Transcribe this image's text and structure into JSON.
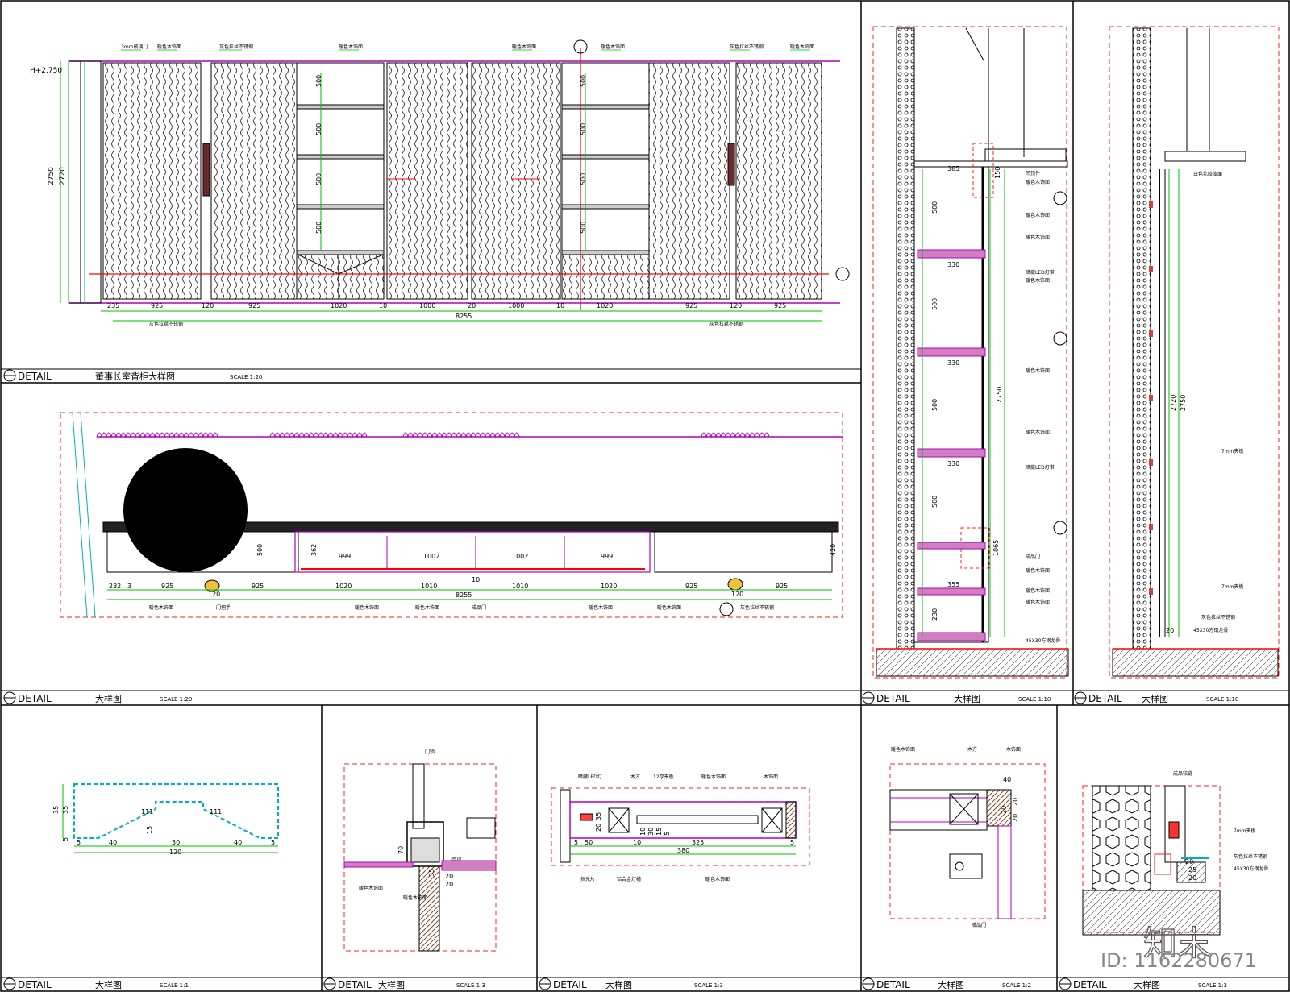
{
  "colors": {
    "frame": "#000000",
    "dim": "#00c000",
    "red": "#ff0000",
    "magenta": "#b000c0",
    "cyan": "#00b0c0",
    "dashed": "#ff2020"
  },
  "panels": [
    {
      "label": "DETAIL",
      "title": "董事长室背柜大样图",
      "scale": "SCALE  1:20"
    },
    {
      "label": "DETAIL",
      "title": "大样图",
      "scale": "SCALE  1:20"
    },
    {
      "label": "DETAIL",
      "title": "大样图",
      "scale": "SCALE  1:10"
    },
    {
      "label": "DETAIL",
      "title": "大样图",
      "scale": "SCALE  1:10"
    },
    {
      "label": "DETAIL",
      "title": "大样图",
      "scale": "SCALE  1:1"
    },
    {
      "label": "DETAIL",
      "title": "大样图",
      "scale": "SCALE  1:3"
    },
    {
      "label": "DETAIL",
      "title": "大样图",
      "scale": "SCALE  1:3"
    },
    {
      "label": "DETAIL",
      "title": "大样图",
      "scale": "SCALE  1:2"
    },
    {
      "label": "DETAIL",
      "title": "大样图",
      "scale": "SCALE  1:3"
    }
  ],
  "elevation": {
    "level": "H+2.750",
    "v1": "2750",
    "v2": "2720",
    "shelf": "500",
    "dims": [
      "235",
      "925",
      "120",
      "925",
      "1020",
      "10",
      "1000",
      "20",
      "1000",
      "10",
      "1020",
      "925",
      "120",
      "925"
    ],
    "total": "8255",
    "notes_top": [
      "3mm玻璃门",
      "暖色木饰面",
      "灰色拉丝不锈钢",
      "暖色木饰面",
      "暖色木饰面",
      "暖色木饰面",
      "灰色拉丝不锈钢",
      "暖色木饰面"
    ],
    "notes_bottom": [
      "灰色拉丝不锈钢",
      "灰色拉丝不锈钢"
    ]
  },
  "plan": {
    "dims": [
      "232",
      "3",
      "925",
      "120",
      "925",
      "1020",
      "1010",
      "10",
      "1010",
      "1020",
      "925",
      "120",
      "925"
    ],
    "inner": [
      "999",
      "1002",
      "1002",
      "999"
    ],
    "depth": [
      "500",
      "362",
      "420"
    ],
    "total": "8255",
    "notes": [
      "暖色木饰面",
      "门把手",
      "暖色木饰面",
      "暖色木饰面",
      "成品门",
      "暖色木饰面",
      "暖色木饰面",
      "灰色拉丝不锈钢"
    ]
  },
  "section_a": {
    "dims": [
      "385",
      "150",
      "330",
      "500",
      "330",
      "500",
      "500",
      "330",
      "500",
      "1065",
      "355",
      "230",
      "2750"
    ],
    "notes": [
      "吊顶件",
      "暖色木饰面",
      "暖色木饰面",
      "暖色木饰面",
      "暗藏LED灯带",
      "暖色木饰面",
      "暖色木饰面",
      "暗藏LED灯带",
      "暖色木饰面",
      "暖色木饰面",
      "成品门",
      "暖色木饰面",
      "暖色木饰面",
      "45X30方钢龙骨"
    ]
  },
  "section_b": {
    "dims": [
      "2720",
      "2750",
      "20"
    ],
    "notes": [
      "白色乳胶漆面",
      "7mm夹板",
      "7mm夹板",
      "灰色拉丝不锈钢",
      "45X30方钢龙骨"
    ]
  },
  "profile": {
    "dims": [
      "35",
      "35",
      "5",
      "111",
      "15",
      "111",
      "40",
      "30",
      "40",
      "5",
      "5",
      "120"
    ]
  },
  "detail_b": {
    "dims": [
      "70",
      "35",
      "20",
      "20"
    ],
    "notes": [
      "门锁",
      "暖色木饰面",
      "暖色木饰面",
      "吊顶"
    ]
  },
  "detail_c": {
    "dims": [
      "20",
      "35",
      "10",
      "30",
      "15",
      "5",
      "325",
      "380",
      "50",
      "10",
      "5",
      "5"
    ],
    "notes": [
      "暗藏LED灯",
      "木方",
      "12厚夹板",
      "暖色木饰面",
      "木饰面",
      "铝合金灯槽",
      "暖色木饰面",
      "挡光片"
    ]
  },
  "detail_d": {
    "dims": [
      "40",
      "20",
      "20",
      "20"
    ],
    "notes": [
      "暖色木饰面",
      "木方",
      "木饰面",
      "成品门"
    ]
  },
  "detail_e": {
    "dims": [
      "20",
      "25",
      "20"
    ],
    "notes": [
      "成品铰链",
      "7mm夹板",
      "灰色拉丝不锈钢",
      "45X30方钢龙骨"
    ]
  },
  "watermark": "ID: 1162280671",
  "brand": "知末"
}
